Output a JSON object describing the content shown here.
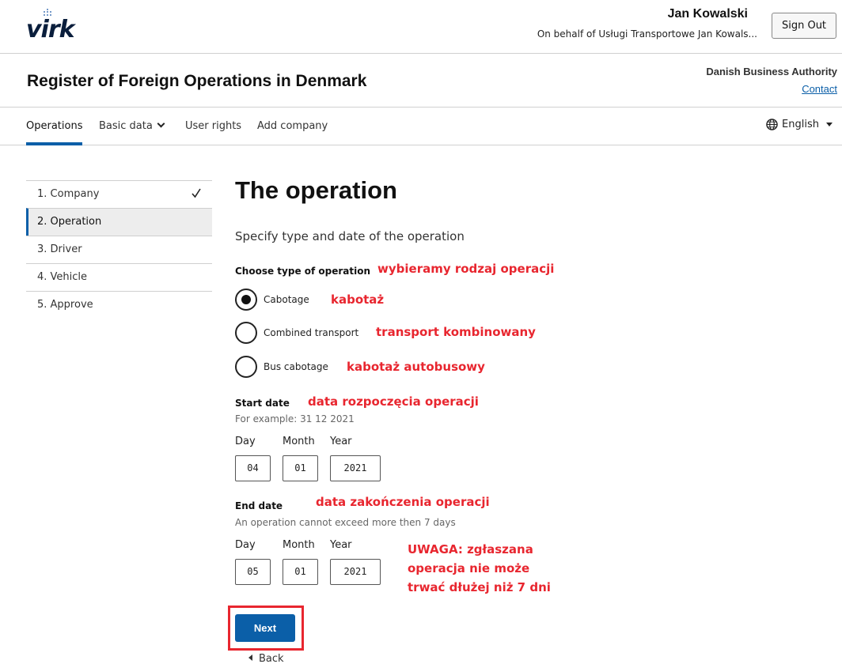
{
  "header": {
    "logo_text": "virk",
    "user_name": "Jan Kowalski",
    "on_behalf": "On behalf of Usługi Transportowe Jan Kowals...",
    "sign_out": "Sign Out"
  },
  "titlebar": {
    "app_title": "Register of Foreign Operations in Denmark",
    "authority": "Danish Business Authority",
    "contact": "Contact"
  },
  "nav": {
    "items": [
      "Operations",
      "Basic data",
      "User rights",
      "Add company"
    ],
    "language": "English"
  },
  "steps": [
    "1. Company",
    "2. Operation",
    "3. Driver",
    "4. Vehicle",
    "5. Approve"
  ],
  "main": {
    "title": "The operation",
    "subtitle": "Specify type and date of the operation",
    "type_label": "Choose type of operation",
    "options": [
      {
        "label": "Cabotage",
        "checked": true
      },
      {
        "label": "Combined transport",
        "checked": false
      },
      {
        "label": "Bus cabotage",
        "checked": false
      }
    ],
    "start": {
      "label": "Start date",
      "hint": "For example: 31 12 2021",
      "day_label": "Day",
      "month_label": "Month",
      "year_label": "Year",
      "day": "04",
      "month": "01",
      "year": "2021"
    },
    "end": {
      "label": "End date",
      "hint": "An operation cannot exceed more then 7 days",
      "day_label": "Day",
      "month_label": "Month",
      "year_label": "Year",
      "day": "05",
      "month": "01",
      "year": "2021"
    },
    "next": "Next",
    "back": "Back"
  },
  "annotations": {
    "type": "wybieramy rodzaj operacji",
    "cabotage": "kabotaż",
    "combined": "transport kombinowany",
    "bus": "kabotaż autobusowy",
    "start": "data rozpoczęcia operacji",
    "end": "data zakończenia operacji",
    "warning_line1": "UWAGA: zgłaszana",
    "warning_line2": "operacja nie może",
    "warning_line3": "trwać dłużej niż 7 dni",
    "color": "#e8262f"
  },
  "colors": {
    "accent": "#0b5fa8",
    "annotation": "#e8262f"
  }
}
